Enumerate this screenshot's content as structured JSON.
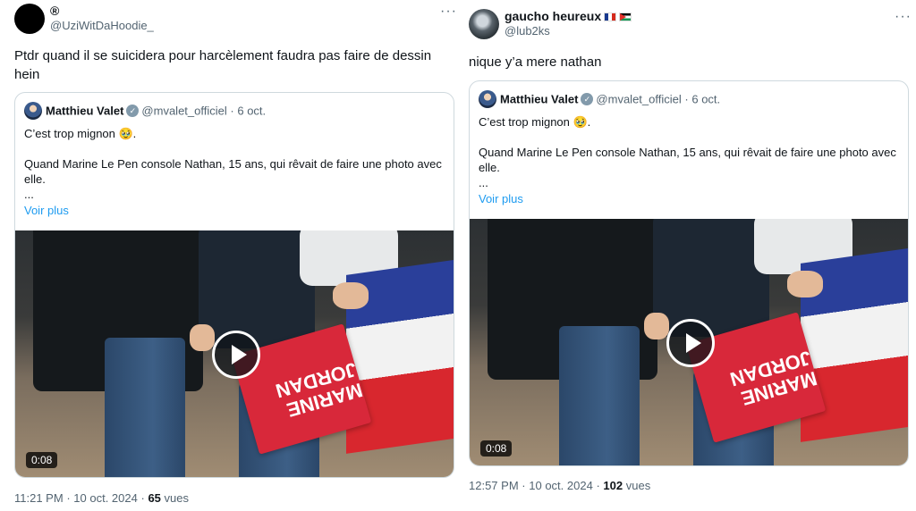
{
  "quoted_tweet": {
    "author_name": "Matthieu Valet",
    "author_handle": "@mvalet_officiel",
    "date_separator": "·",
    "date": "6 oct.",
    "line1": "C’est trop mignon 🥹.",
    "line2": "Quand Marine Le Pen console Nathan, 15 ans, qui rêvait de faire une photo avec elle.",
    "ellipsis": "...",
    "more_label": "Voir plus",
    "video_duration": "0:08",
    "sign_text": "MARINE JORDAN"
  },
  "tweets": [
    {
      "display_name": "®",
      "handle": "@UziWitDaHoodie_",
      "text": "Ptdr quand il se suicidera pour harcèlement faudra pas faire de dessin hein",
      "time": "11:21 PM",
      "date": "10 oct. 2024",
      "views_count": "65",
      "views_label": "vues"
    },
    {
      "display_name": "gaucho heureux",
      "flags": [
        "fr-flag-icon",
        "ps-flag-icon"
      ],
      "handle": "@lub2ks",
      "text": "nique y’a mere nathan",
      "time": "12:57 PM",
      "date": "10 oct. 2024",
      "views_count": "102",
      "views_label": "vues"
    }
  ],
  "ui": {
    "more_glyph": "···",
    "dot": "·",
    "verified_glyph": "✓"
  }
}
